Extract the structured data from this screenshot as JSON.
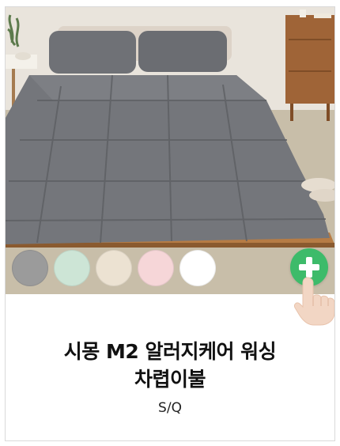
{
  "product": {
    "title_line1": "시몽 M2 알러지케어 워싱",
    "title_line2": "차렵이불",
    "size": "S/Q"
  },
  "colors": {
    "swatches": [
      "#9b9b9b",
      "#cde5d6",
      "#ece2d2",
      "#f6d6d8",
      "#ffffff"
    ],
    "accent": "#3dbb6a",
    "comforter": "#74767b"
  },
  "icons": {
    "add": "plus-icon",
    "hint": "pointing-hand-icon"
  }
}
